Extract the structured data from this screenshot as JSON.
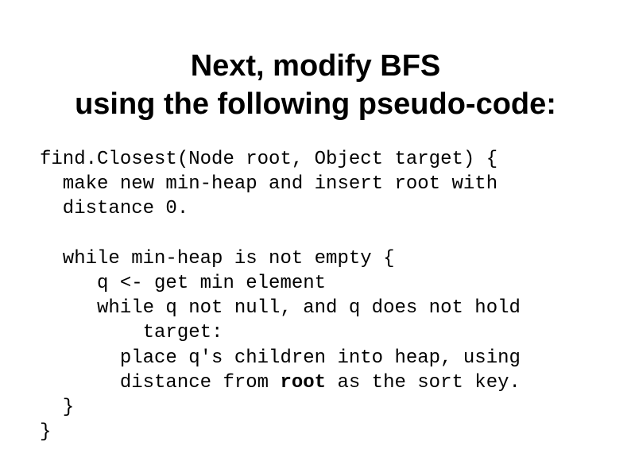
{
  "title_line1": "Next, modify BFS",
  "title_line2": "using the following pseudo-code:",
  "code": {
    "l1": "find.Closest(Node root, Object target) {",
    "l2": "  make new min-heap and insert root with",
    "l3": "  distance 0.",
    "l4": "",
    "l5": "  while min-heap is not empty {",
    "l6": "     q <- get min element",
    "l7": "     while q not null, and q does not hold",
    "l8": "         target:",
    "l9a": "       place q's children into heap, using",
    "l10a": "       distance from ",
    "l10b": "root",
    "l10c": " as the sort key.",
    "l11": "  }",
    "l12": "}"
  }
}
